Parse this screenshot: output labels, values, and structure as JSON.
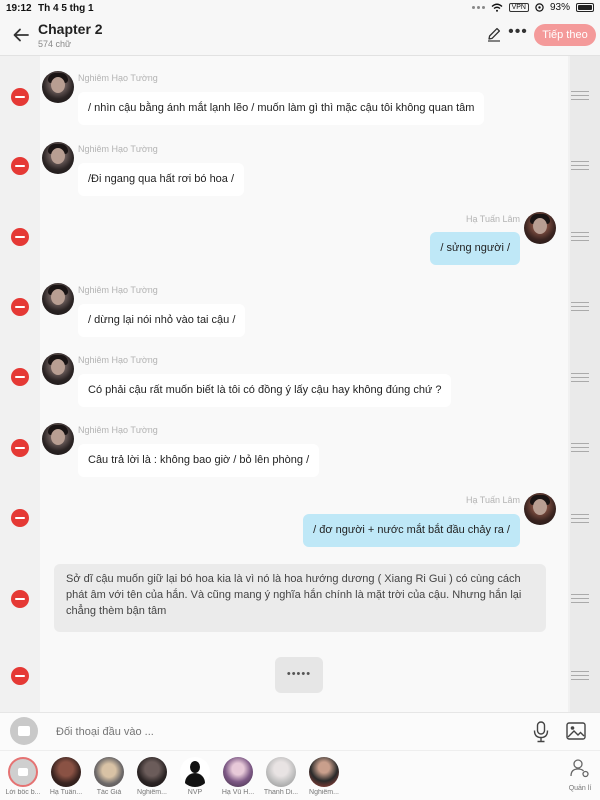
{
  "status_bar": {
    "time": "19:12",
    "date": "Th 4 5 thg 1",
    "battery": "93%",
    "vpn": "VPN"
  },
  "header": {
    "title": "Chapter 2",
    "subtitle": "574 chữ",
    "follow_label": "Tiếp theo"
  },
  "messages": [
    {
      "side": "left",
      "name": "Nghiêm Hạo Tường",
      "text": "/ nhìn cậu bằng ánh mắt lạnh lẽo / muốn làm gì thì mặc cậu tôi không quan tâm"
    },
    {
      "side": "left",
      "name": "Nghiêm Hạo Tường",
      "text": "/Đi ngang qua hất rơi bó hoa  /"
    },
    {
      "side": "right",
      "name": "Hạ Tuấn Lâm",
      "text": "/ sửng  người /"
    },
    {
      "side": "left",
      "name": "Nghiêm Hạo Tường",
      "text": "/ dừng lại nói nhỏ vào tai cậu /"
    },
    {
      "side": "left",
      "name": "Nghiêm Hạo Tường",
      "text": "Có phải cậu rất muốn biết là tôi có đồng ý lấy cậu hay không đúng chứ ?"
    },
    {
      "side": "left",
      "name": "Nghiêm Hạo Tường",
      "text": "Câu trả lời  là : không bao giờ / bỏ lên phòng /"
    },
    {
      "side": "right",
      "name": "Hạ Tuấn Lâm",
      "text": "/ đơ người + nước mắt bắt đầu chảy ra  /"
    },
    {
      "side": "narration",
      "text": "Sở dĩ cậu muốn giữ lại bó hoa kia là vì nó là hoa hướng dương ( Xiang Ri Gui ) có cùng cách phát âm với tên của hắn. Và cũng mang ý nghĩa hắn chính là mặt trời của cậu. Nhưng hắn lại chẳng thèm bận tâm"
    },
    {
      "side": "typing",
      "text": "•••••"
    }
  ],
  "composer": {
    "placeholder": "Đối thoại đầu vào ..."
  },
  "characters": [
    {
      "label": "Lời bốc b...",
      "style": "narr"
    },
    {
      "label": "Hạ Tuấn...",
      "style": "red"
    },
    {
      "label": "Tác Giả",
      "style": "warm"
    },
    {
      "label": "Nghiêm...",
      "style": "dark"
    },
    {
      "label": "NVP",
      "style": "sil"
    },
    {
      "label": "Hạ  Vũ H...",
      "style": "purple"
    },
    {
      "label": "Thanh Di...",
      "style": "grey"
    },
    {
      "label": "Nghiêm...",
      "style": "suit"
    }
  ],
  "manage_label": "Quản lí",
  "colors": {
    "delete": "#e53935",
    "follow": "#f49a9a",
    "right_bubble": "#bfe8f7"
  }
}
